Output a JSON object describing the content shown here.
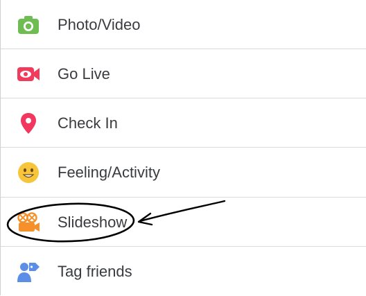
{
  "menu": {
    "items": [
      {
        "label": "Photo/Video",
        "icon": "photo-video-icon",
        "color": "#6fbd52"
      },
      {
        "label": "Go Live",
        "icon": "live-video-icon",
        "color": "#f23b5c"
      },
      {
        "label": "Check In",
        "icon": "location-pin-icon",
        "color": "#f2365e"
      },
      {
        "label": "Feeling/Activity",
        "icon": "smiley-icon",
        "color": "#f7c53b"
      },
      {
        "label": "Slideshow",
        "icon": "film-camera-icon",
        "color": "#f5902b"
      },
      {
        "label": "Tag friends",
        "icon": "tag-person-icon",
        "color": "#5b8ee6"
      }
    ]
  },
  "annotation": {
    "shape": "ellipse-circle-around-slideshow",
    "arrow": "hand-drawn-arrow-pointing-to-slideshow",
    "color": "#000000"
  }
}
